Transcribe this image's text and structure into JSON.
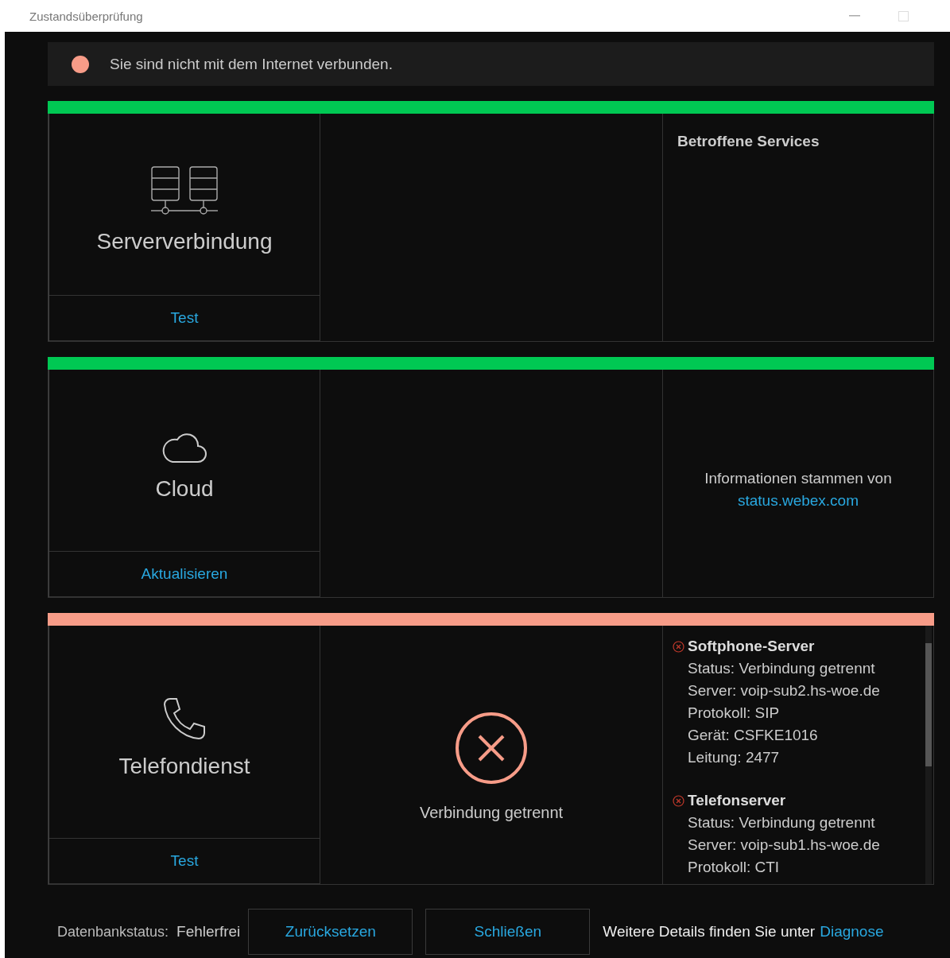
{
  "window": {
    "title": "Zustandsüberprüfung"
  },
  "banner": {
    "text": "Sie sind nicht mit dem Internet verbunden.",
    "color": "#f79c88"
  },
  "panels": [
    {
      "kind": "server",
      "title": "Serververbindung",
      "color": "#00c853",
      "action": "Test",
      "side": {
        "kind": "heading",
        "heading": "Betroffene Services"
      }
    },
    {
      "kind": "cloud",
      "title": "Cloud",
      "color": "#00c853",
      "action": "Aktualisieren",
      "side": {
        "kind": "source",
        "text": "Informationen stammen von",
        "link": "status.webex.com"
      }
    },
    {
      "kind": "phone",
      "title": "Telefondienst",
      "color": "#f79c88",
      "action": "Test",
      "status": {
        "kind": "error",
        "text": "Verbindung getrennt"
      },
      "side": {
        "kind": "services",
        "services": [
          {
            "name": "Softphone-Server",
            "lines": [
              "Status: Verbindung getrennt",
              "Server: voip-sub2.hs-woe.de",
              "Protokoll: SIP",
              "Gerät: CSFKE1016",
              "Leitung: 2477"
            ]
          },
          {
            "name": "Telefonserver",
            "lines": [
              "Status: Verbindung getrennt",
              "Server: voip-sub1.hs-woe.de",
              "Protokoll: CTI"
            ]
          }
        ]
      }
    }
  ],
  "footer": {
    "db_label": "Datenbankstatus:",
    "db_value": "Fehlerfrei",
    "buttons": [
      "Zurücksetzen",
      "Schließen"
    ],
    "hint": "Weitere Details finden Sie unter",
    "link": "Diagnose"
  }
}
